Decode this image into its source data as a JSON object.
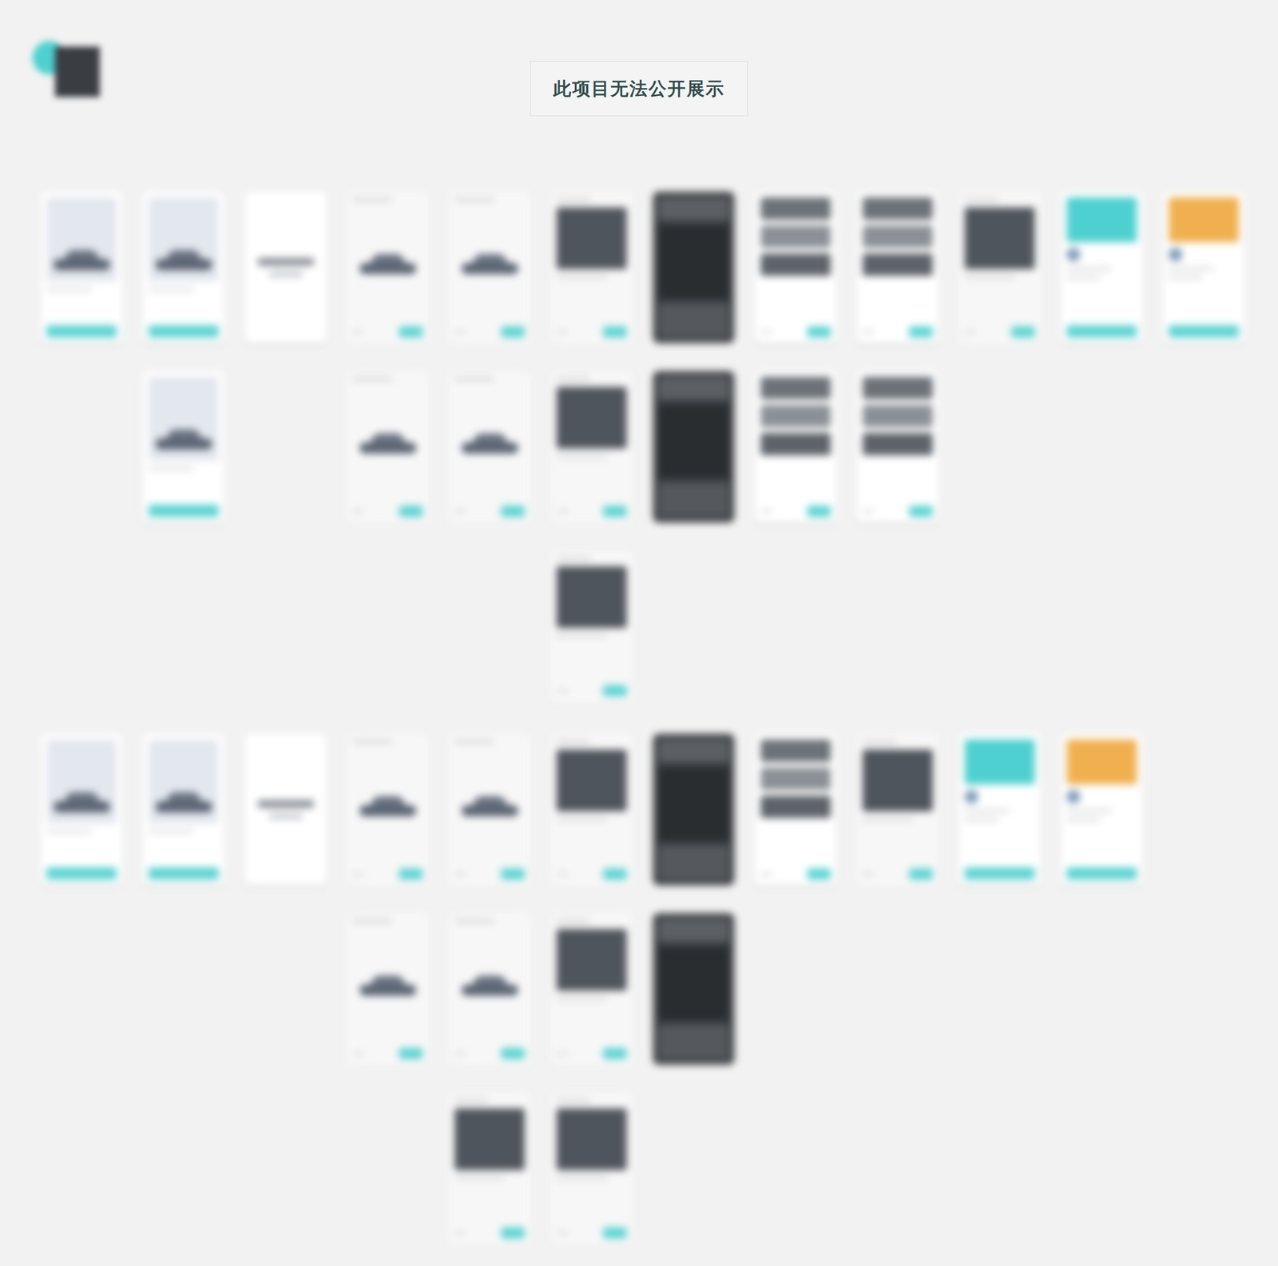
{
  "title": "此项目无法公开展示",
  "boards": [
    {
      "columns": [
        {
          "screens": [
            {
              "kind": "light"
            }
          ]
        },
        {
          "screens": [
            {
              "kind": "light"
            },
            {
              "kind": "light"
            }
          ]
        },
        {
          "screens": [
            {
              "kind": "white"
            }
          ]
        },
        {
          "screens": [
            {
              "kind": "car"
            },
            {
              "kind": "car"
            }
          ]
        },
        {
          "screens": [
            {
              "kind": "car"
            },
            {
              "kind": "car"
            }
          ]
        },
        {
          "screens": [
            {
              "kind": "photo"
            },
            {
              "kind": "photo"
            },
            {
              "kind": "photo"
            }
          ]
        },
        {
          "screens": [
            {
              "kind": "dark"
            },
            {
              "kind": "dark"
            }
          ]
        },
        {
          "screens": [
            {
              "kind": "list"
            },
            {
              "kind": "list"
            }
          ]
        },
        {
          "screens": [
            {
              "kind": "list"
            },
            {
              "kind": "list"
            }
          ]
        },
        {
          "screens": [
            {
              "kind": "photo"
            }
          ]
        },
        {
          "screens": [
            {
              "kind": "teal"
            }
          ]
        },
        {
          "screens": [
            {
              "kind": "orange"
            }
          ]
        }
      ]
    },
    {
      "columns": [
        {
          "screens": [
            {
              "kind": "light"
            }
          ]
        },
        {
          "screens": [
            {
              "kind": "light"
            }
          ]
        },
        {
          "screens": [
            {
              "kind": "white"
            }
          ]
        },
        {
          "screens": [
            {
              "kind": "car"
            },
            {
              "kind": "car"
            }
          ]
        },
        {
          "screens": [
            {
              "kind": "car"
            },
            {
              "kind": "car"
            },
            {
              "kind": "photo"
            }
          ]
        },
        {
          "screens": [
            {
              "kind": "photo"
            },
            {
              "kind": "photo"
            },
            {
              "kind": "photo"
            }
          ]
        },
        {
          "screens": [
            {
              "kind": "dark"
            },
            {
              "kind": "dark"
            }
          ]
        },
        {
          "screens": [
            {
              "kind": "list"
            }
          ]
        },
        {
          "screens": [
            {
              "kind": "photo"
            }
          ]
        },
        {
          "screens": [
            {
              "kind": "teal"
            }
          ]
        },
        {
          "screens": [
            {
              "kind": "orange"
            }
          ]
        }
      ]
    }
  ]
}
